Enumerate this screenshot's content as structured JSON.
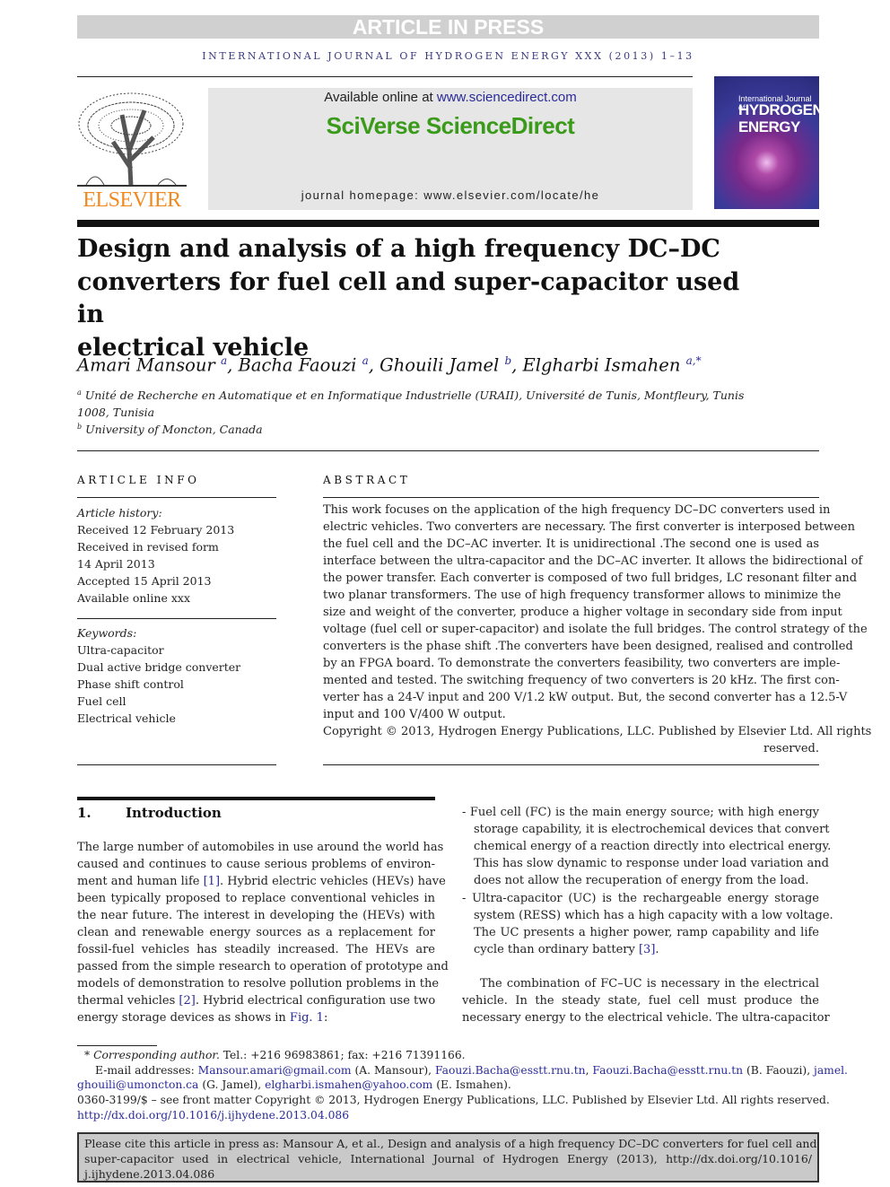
{
  "banner": {
    "article_in_press": "ARTICLE IN PRESS",
    "journal_line": "INTERNATIONAL JOURNAL OF HYDROGEN ENERGY XXX (2013) 1–13"
  },
  "header": {
    "available_prefix": "Available online at ",
    "available_link": "www.sciencedirect.com",
    "sciverse": "SciVerse ScienceDirect",
    "homepage": "journal homepage: www.elsevier.com/locate/he",
    "publisher_logo": "ELSEVIER",
    "cover_small": "International Journal of",
    "cover_big1": "HYDROGEN",
    "cover_big2": "ENERGY"
  },
  "title_lines": [
    "Design and analysis of a high frequency DC–DC",
    "converters for fuel cell and super-capacitor used in",
    "electrical vehicle"
  ],
  "authors": [
    {
      "name": "Amari Mansour",
      "sup": "a"
    },
    {
      "name": "Bacha Faouzi",
      "sup": "a"
    },
    {
      "name": "Ghouili Jamel",
      "sup": "b"
    },
    {
      "name": "Elgharbi Ismahen",
      "sup": "a,*"
    }
  ],
  "affiliations": {
    "a_mark": "a",
    "a_line1": "Unité de Recherche en Automatique et en Informatique Industrielle (URAII), Université de Tunis, Montfleury, Tunis",
    "a_line2": "1008, Tunisia",
    "b_mark": "b",
    "b_line1": "University of Moncton, Canada"
  },
  "article_info": {
    "heading": "ARTICLE INFO",
    "history_label": "Article history:",
    "history": [
      "Received 12 February 2013",
      "Received in revised form",
      "14 April 2013",
      "Accepted 15 April 2013",
      "Available online xxx"
    ],
    "keywords_label": "Keywords:",
    "keywords": [
      "Ultra-capacitor",
      "Dual active bridge converter",
      "Phase shift control",
      "Fuel cell",
      "Electrical vehicle"
    ]
  },
  "abstract": {
    "heading": "ABSTRACT",
    "lines": [
      "This work focuses on the application of the high frequency DC–DC converters used in",
      "electric vehicles. Two converters are necessary. The first converter is interposed between",
      "the fuel cell and the DC–AC inverter. It is unidirectional .The second one is used as",
      "interface between the ultra-capacitor and the DC–AC inverter. It allows the bidirectional of",
      "the power transfer. Each converter is composed of two full bridges, LC resonant filter and",
      "two planar transformers. The use of high frequency transformer allows to minimize the",
      "size and weight of the converter, produce a higher voltage in secondary side from input",
      "voltage (fuel cell or super-capacitor) and isolate the full bridges. The control strategy of the",
      "converters is the phase shift .The converters have been designed, realised and controlled",
      "by an FPGA board. To demonstrate the converters feasibility, two converters are imple-",
      "mented and tested. The switching frequency of two converters is 20 kHz. The first con-",
      "verter has a 24-V input and 200 V/1.2 kW output. But, the second converter has a 12.5-V",
      "input and 100 V/400 W output."
    ],
    "copyright_lines": [
      "Copyright © 2013, Hydrogen Energy Publications, LLC. Published by Elsevier Ltd. All rights",
      "reserved."
    ]
  },
  "intro": {
    "number": "1.",
    "heading": "Introduction",
    "left_lines": [
      [
        {
          "t": "The large number of automobiles in use around the world has"
        }
      ],
      [
        {
          "t": "caused and continues to cause serious problems of environ-"
        }
      ],
      [
        {
          "t": "ment and human life "
        },
        {
          "t": "[1]",
          "link": true
        },
        {
          "t": ". Hybrid electric vehicles (HEVs) have"
        }
      ],
      [
        {
          "t": "been typically proposed to replace conventional vehicles in"
        }
      ],
      [
        {
          "t": "the near future. The interest in developing the (HEVs) with"
        }
      ],
      [
        {
          "t": "clean and renewable energy sources as a replacement for"
        }
      ],
      [
        {
          "t": "fossil-fuel vehicles has steadily increased. The HEVs are"
        }
      ],
      [
        {
          "t": "passed from the simple research to operation of prototype and"
        }
      ],
      [
        {
          "t": "models of demonstration to resolve pollution problems in the"
        }
      ],
      [
        {
          "t": "thermal vehicles "
        },
        {
          "t": "[2]",
          "link": true
        },
        {
          "t": ". Hybrid electrical configuration use two"
        }
      ],
      [
        {
          "t": "energy storage devices as shows in "
        },
        {
          "t": "Fig. 1",
          "link": true
        },
        {
          "t": ":"
        }
      ]
    ],
    "bullet1": [
      [
        {
          "t": "-  Fuel cell (FC) is the main energy source; with high energy"
        }
      ],
      [
        {
          "t": "storage capability, it is electrochemical devices that convert"
        }
      ],
      [
        {
          "t": "chemical energy of a reaction directly into electrical energy."
        }
      ],
      [
        {
          "t": "This has slow dynamic to response under load variation and"
        }
      ],
      [
        {
          "t": "does not allow the recuperation of energy from the load."
        }
      ]
    ],
    "bullet2": [
      [
        {
          "t": "-  Ultra-capacitor (UC) is the rechargeable energy storage"
        }
      ],
      [
        {
          "t": "system (RESS) which has a high capacity with a low voltage."
        }
      ],
      [
        {
          "t": "The UC presents a higher power, ramp capability and life"
        }
      ],
      [
        {
          "t": "cycle than ordinary battery "
        },
        {
          "t": "[3]",
          "link": true
        },
        {
          "t": "."
        }
      ]
    ],
    "para2": [
      [
        {
          "t": "The combination of FC–UC is necessary in the electrical"
        }
      ],
      [
        {
          "t": "vehicle. In the steady state, fuel cell must produce the"
        }
      ],
      [
        {
          "t": "necessary energy to the electrical vehicle. The ultra-capacitor"
        }
      ]
    ]
  },
  "footnotes": {
    "l1": [
      {
        "t": "* "
      },
      {
        "t": "Corresponding author."
      },
      {
        "t": " Tel.: +216 96983861; fax: +216 71391166."
      }
    ],
    "l2": [
      {
        "t": "E-mail addresses: "
      },
      {
        "t": "Mansour.amari@gmail.com",
        "link": true
      },
      {
        "t": " (A. Mansour), "
      },
      {
        "t": "Faouzi.Bacha@esstt.rnu.tn",
        "link": true
      },
      {
        "t": ", "
      },
      {
        "t": "Faouzi.Bacha@esstt.rnu.tn",
        "link": true
      },
      {
        "t": " (B. Faouzi), "
      },
      {
        "t": "jamel.",
        "link": true
      }
    ],
    "l3": [
      {
        "t": "ghouili@umoncton.ca",
        "link": true
      },
      {
        "t": " (G. Jamel), "
      },
      {
        "t": "elgharbi.ismahen@yahoo.com",
        "link": true
      },
      {
        "t": " (E. Ismahen)."
      }
    ],
    "l4": [
      {
        "t": "0360-3199/$ – see front matter Copyright © 2013, Hydrogen Energy Publications, LLC. Published by Elsevier Ltd. All rights reserved."
      }
    ],
    "l5": [
      {
        "t": "http://dx.doi.org/10.1016/j.ijhydene.2013.04.086",
        "link": true
      }
    ]
  },
  "cite_lines": [
    "Please cite this article in press as: Mansour A, et al., Design and analysis of a high frequency DC–DC converters for fuel cell and",
    "super-capacitor used in electrical vehicle, International Journal of Hydrogen Energy (2013), http://dx.doi.org/10.1016/",
    "j.ijhydene.2013.04.086"
  ],
  "colors": {
    "link": "#2a2a9a",
    "sciverse_green": "#3a9a1a",
    "elsevier_orange": "#f08a20"
  }
}
